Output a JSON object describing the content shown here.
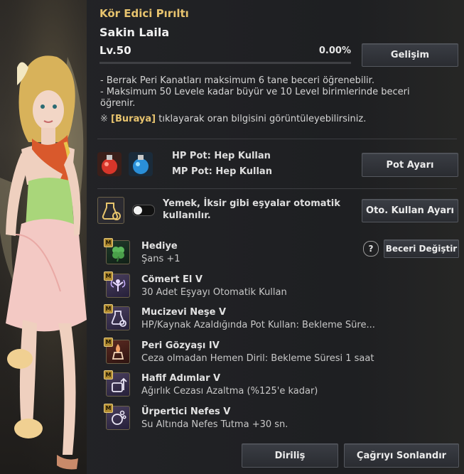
{
  "header": {
    "title": "Kör Edici Pırıltı",
    "name": "Sakin Laila",
    "level": "Lv.50",
    "progress_text": "0.00%",
    "progress_fraction": 0.0,
    "develop_button": "Gelişim"
  },
  "info": {
    "line1": "- Berrak Peri Kanatları maksimum 6 tane beceri öğrenebilir.",
    "line2a": "- Maksimum 50 Levele kadar büyür ve 10 Level birimlerinde beceri",
    "line2b": "öğrenir.",
    "note_mark": "※",
    "link_text": "[Buraya]",
    "note_rest": "tıklayarak oran bilgisini görüntüleyebilirsiniz."
  },
  "potions": {
    "hp": "HP Pot: Hep Kullan",
    "mp": "MP Pot: Hep Kullan",
    "button": "Pot Ayarı"
  },
  "auto_use": {
    "text_line1": "Yemek, İksir gibi eşyalar otomatik",
    "text_line2": "kullanılır.",
    "button": "Oto. Kullan Ayarı",
    "toggle_on": false
  },
  "skills_header": {
    "help_icon": "?",
    "change_button": "Beceri Değiştir"
  },
  "skills": [
    {
      "badge": "M",
      "name": "Hediye",
      "desc": "Şans +1",
      "icon": "clover-icon"
    },
    {
      "badge": "M",
      "name": "Cömert El V",
      "desc": "30 Adet Eşyayı Otomatik Kullan",
      "icon": "fairy-icon"
    },
    {
      "badge": "M",
      "name": "Mucizevi Neşe V",
      "desc": "HP/Kaynak Azaldığında Pot Kullan: Bekleme Süre...",
      "icon": "potion-gear-icon"
    },
    {
      "badge": "M",
      "name": "Peri Gözyaşı IV",
      "desc": "Ceza olmadan Hemen Diril: Bekleme Süresi 1 saat",
      "icon": "tear-potion-icon"
    },
    {
      "badge": "M",
      "name": "Hafif Adımlar V",
      "desc": "Ağırlık Cezası Azaltma (%125'e kadar)",
      "icon": "weight-icon"
    },
    {
      "badge": "M",
      "name": "Ürpertici Nefes V",
      "desc": "Su Altında Nefes Tutma +30 sn.",
      "icon": "breath-icon"
    }
  ],
  "footer": {
    "revive_button": "Diriliş",
    "end_call_button": "Çağrıyı Sonlandır"
  },
  "colors": {
    "accent_gold": "#e7c36e",
    "panel_bg": "#222326"
  }
}
